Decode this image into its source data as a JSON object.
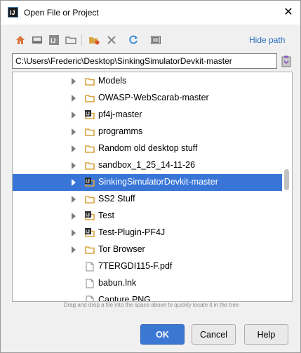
{
  "window": {
    "title": "Open File or Project",
    "close_glyph": "✕"
  },
  "toolbar": {
    "buttons": [
      {
        "name": "home-icon"
      },
      {
        "name": "desktop-icon"
      },
      {
        "name": "project-icon"
      },
      {
        "name": "module-icon"
      },
      {
        "name": "new-folder-icon"
      },
      {
        "name": "delete-icon"
      },
      {
        "name": "refresh-icon"
      },
      {
        "name": "show-hidden-icon"
      }
    ],
    "hide_path_label": "Hide path"
  },
  "path": {
    "value": "C:\\Users\\Frederic\\Desktop\\SinkingSimulatorDevkit-master"
  },
  "tree": {
    "items": [
      {
        "label": "Models",
        "type": "folder",
        "expandable": true,
        "selected": false
      },
      {
        "label": "OWASP-WebScarab-master",
        "type": "folder",
        "expandable": true,
        "selected": false
      },
      {
        "label": "pf4j-master",
        "type": "project",
        "expandable": true,
        "selected": false
      },
      {
        "label": "programms",
        "type": "folder",
        "expandable": true,
        "selected": false
      },
      {
        "label": "Random old desktop stuff",
        "type": "folder",
        "expandable": true,
        "selected": false
      },
      {
        "label": "sandbox_1_25_14-11-26",
        "type": "folder",
        "expandable": true,
        "selected": false
      },
      {
        "label": "SinkingSimulatorDevkit-master",
        "type": "project",
        "expandable": true,
        "selected": true
      },
      {
        "label": "SS2 Stuff",
        "type": "folder",
        "expandable": true,
        "selected": false
      },
      {
        "label": "Test",
        "type": "project",
        "expandable": true,
        "selected": false
      },
      {
        "label": "Test-Plugin-PF4J",
        "type": "project",
        "expandable": true,
        "selected": false
      },
      {
        "label": "Tor Browser",
        "type": "folder",
        "expandable": true,
        "selected": false
      },
      {
        "label": "7TERGDI115-F.pdf",
        "type": "file",
        "expandable": false,
        "selected": false
      },
      {
        "label": "babun.lnk",
        "type": "file",
        "expandable": false,
        "selected": false
      },
      {
        "label": "Capture.PNG",
        "type": "file",
        "expandable": false,
        "selected": false
      }
    ]
  },
  "hint": "Drag and drop a file into the space above to quickly locate it in the tree",
  "buttons": {
    "ok": "OK",
    "cancel": "Cancel",
    "help": "Help"
  },
  "colors": {
    "selection": "#3875d7",
    "link": "#2a6fbf",
    "folder": "#d9a441"
  }
}
